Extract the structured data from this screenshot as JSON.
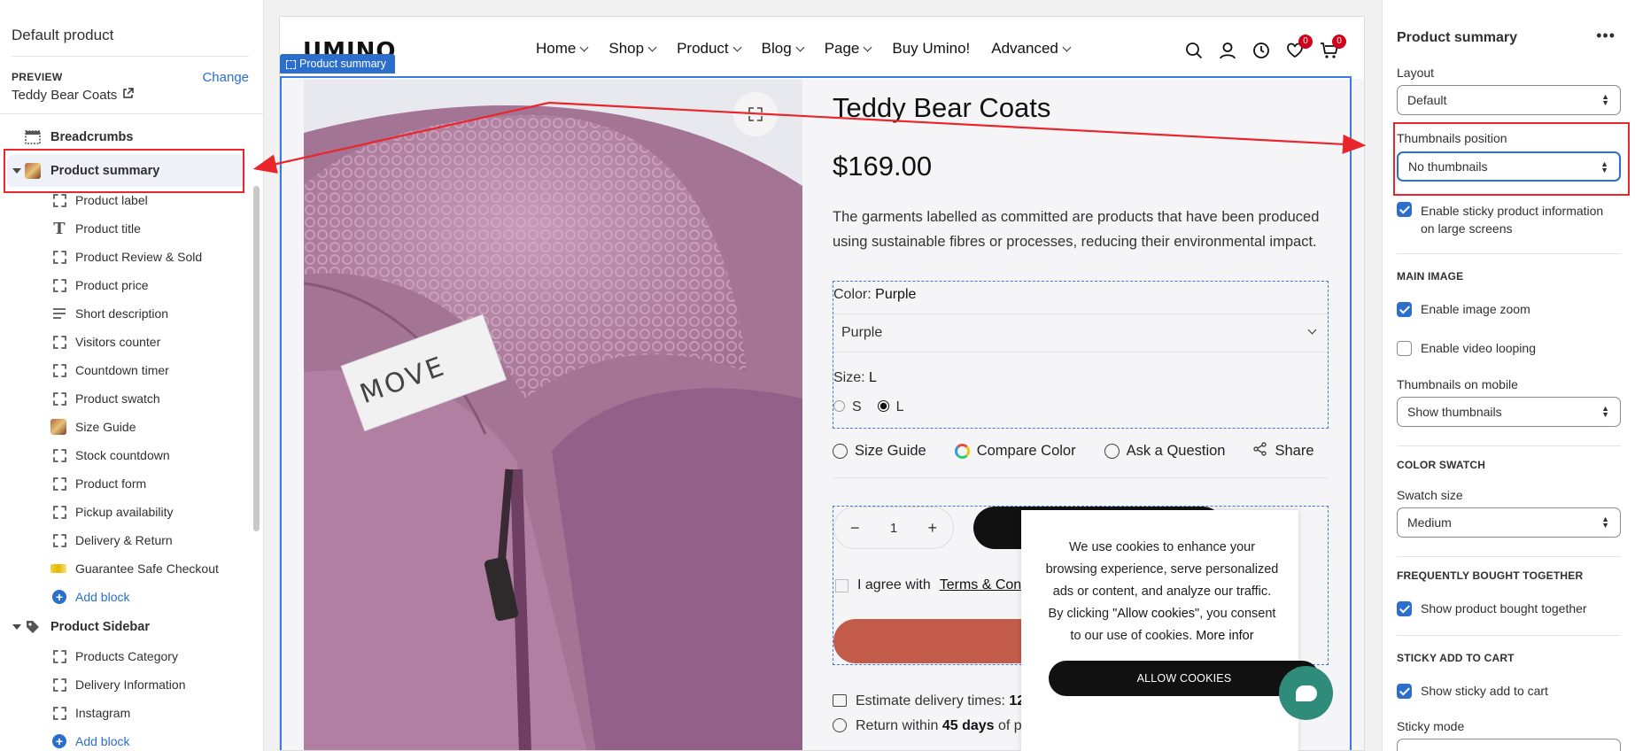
{
  "left": {
    "title": "Default product",
    "preview_label": "PREVIEW",
    "change": "Change",
    "preview_value": "Teddy Bear Coats",
    "tree": [
      {
        "label": "Breadcrumbs"
      },
      {
        "label": "Product summary"
      },
      {
        "label": "Product label"
      },
      {
        "label": "Product title"
      },
      {
        "label": "Product Review & Sold"
      },
      {
        "label": "Product price"
      },
      {
        "label": "Short description"
      },
      {
        "label": "Visitors counter"
      },
      {
        "label": "Countdown timer"
      },
      {
        "label": "Product swatch"
      },
      {
        "label": "Size Guide"
      },
      {
        "label": "Stock countdown"
      },
      {
        "label": "Product form"
      },
      {
        "label": "Pickup availability"
      },
      {
        "label": "Delivery & Return"
      },
      {
        "label": "Guarantee Safe Checkout"
      },
      {
        "label": "Add block"
      },
      {
        "label": "Product Sidebar"
      },
      {
        "label": "Products Category"
      },
      {
        "label": "Delivery Information"
      },
      {
        "label": "Instagram"
      },
      {
        "label": "Add block"
      }
    ]
  },
  "site": {
    "logo": "UMINO",
    "nav": [
      "Home",
      "Shop",
      "Product",
      "Blog",
      "Page",
      "Buy Umino!",
      "Advanced"
    ],
    "wishlist_count": "0",
    "cart_count": "0",
    "section_tag": "Product summary",
    "image_label": "MOVE"
  },
  "product": {
    "title": "Teddy Bear Coats",
    "price": "$169.00",
    "description": "The garments labelled as committed are products that have been produced using sustainable fibres or processes, reducing their environmental impact.",
    "color_label": "Color:",
    "color_value": "Purple",
    "color_select": "Purple",
    "size_label": "Size:",
    "size_value": "L",
    "sizes": [
      "S",
      "L"
    ],
    "links": [
      "Size Guide",
      "Compare Color",
      "Ask a Question",
      "Share"
    ],
    "qty": "1",
    "agree": "I agree with",
    "terms": "Terms & Condi",
    "delivery_prefix": "Estimate delivery times:",
    "delivery_value": "12",
    "return_prefix": "Return within",
    "return_value": "45 days",
    "return_suffix": "of p"
  },
  "cookie": {
    "text_1": "We use cookies to enhance your browsing experience, serve personalized ads or content, and analyze our traffic. By clicking",
    "text_allow": "\"Allow cookies\"",
    "text_2": ", you consent to our use of cookies.",
    "more": "More infor",
    "button": "ALLOW COOKIES"
  },
  "right": {
    "title": "Product summary",
    "more": "•••",
    "layout_label": "Layout",
    "layout_value": "Default",
    "thumbs_label": "Thumbnails position",
    "thumbs_value": "No thumbnails",
    "sticky_info": "Enable sticky product information on large screens",
    "main_image": "MAIN IMAGE",
    "zoom": "Enable image zoom",
    "video_loop": "Enable video looping",
    "thumbs_mobile_label": "Thumbnails on mobile",
    "thumbs_mobile_value": "Show thumbnails",
    "color_swatch": "COLOR SWATCH",
    "swatch_size_label": "Swatch size",
    "swatch_size_value": "Medium",
    "fbt": "FREQUENTLY BOUGHT TOGETHER",
    "fbt_check": "Show product bought together",
    "sticky_cart": "STICKY ADD TO CART",
    "sticky_cart_check": "Show sticky add to cart",
    "sticky_mode": "Sticky mode"
  },
  "colors": {
    "accent": "#2c6ecb",
    "annotation_red": "#e8262b",
    "buy_now": "#c25b4a",
    "chat": "#2f8b7a"
  }
}
